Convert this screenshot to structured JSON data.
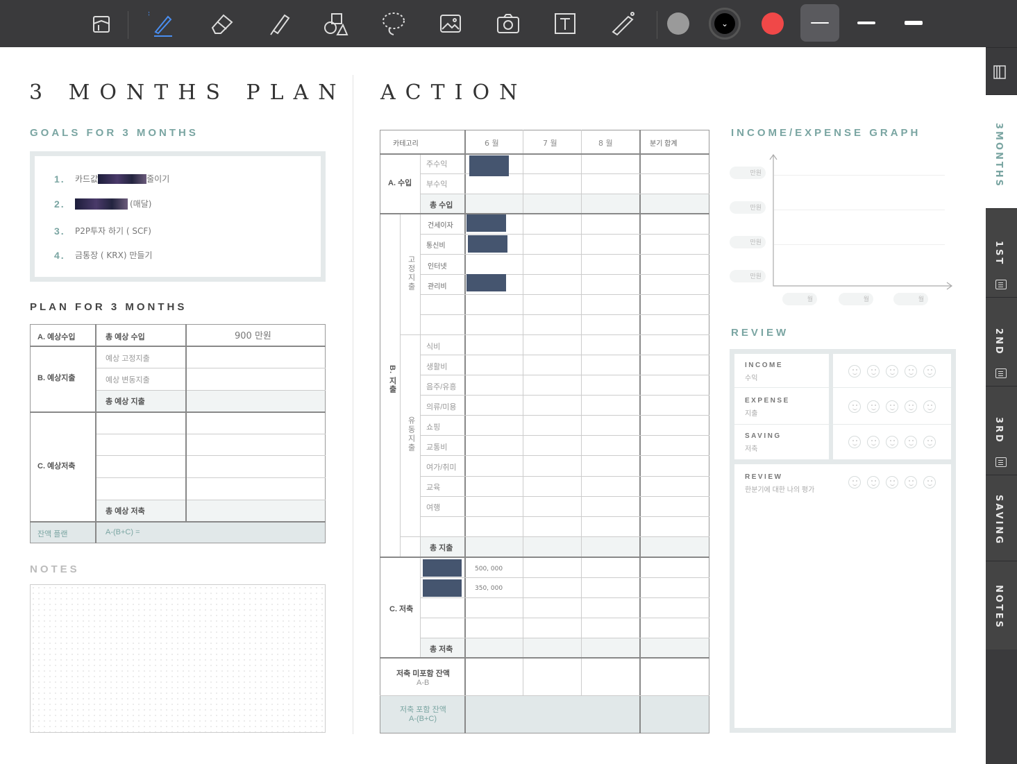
{
  "toolbar": {
    "tools": [
      "page-settings",
      "pen",
      "eraser",
      "highlighter",
      "shapes",
      "lasso",
      "image",
      "camera",
      "text",
      "laser-pointer"
    ],
    "colors": [
      "#9a9a9a",
      "#000000",
      "#f04848"
    ],
    "selected_color_chevron": "⌄"
  },
  "right_tabs": [
    "3MONTHS",
    "1ST",
    "2ND",
    "3RD",
    "SAVING",
    "NOTES"
  ],
  "left": {
    "title": "3 MONTHS PLAN",
    "goals_title": "GOALS FOR 3 MONTHS",
    "goals": [
      {
        "num": "1.",
        "text_a": "카드값 ",
        "text_b": "줄이기"
      },
      {
        "num": "2.",
        "text_a": "",
        "text_b": "(매달)"
      },
      {
        "num": "3.",
        "text_a": "P2P투자 하기 ( SCF)",
        "text_b": ""
      },
      {
        "num": "4.",
        "text_a": "금통장 ( KRX) 만들기",
        "text_b": ""
      }
    ],
    "plan_title": "PLAN FOR 3 MONTHS",
    "plan": {
      "a_label": "A. 예상수입",
      "a_total": "총 예상 수입",
      "a_value": "900 만원",
      "b_label": "B. 예상지출",
      "b_fixed": "예상 고정지출",
      "b_var": "예상 변동지출",
      "b_total": "총 예상 지출",
      "c_label": "C. 예상저축",
      "c_total": "총 예상 저축",
      "balance_label": "잔액 플랜",
      "balance_formula": "A-(B+C) ="
    },
    "notes_title": "NOTES"
  },
  "action": {
    "title": "ACTION",
    "headers": [
      "카테고리",
      "6 월",
      "7 월",
      "8 월",
      "분기 합계"
    ],
    "income_label": "A. 수입",
    "income_rows": [
      "주수익",
      "부수익"
    ],
    "income_total": "총 수입",
    "expense_label": "B. 지출",
    "fixed_label": "고정지출",
    "fixed_rows": [
      "건세이자",
      "통신비",
      "인터넷",
      "관리비"
    ],
    "var_label": "유동지출",
    "var_rows": [
      "식비",
      "생활비",
      "음주/유흥",
      "의류/미용",
      "쇼핑",
      "교통비",
      "여가/취미",
      "교육",
      "여행"
    ],
    "expense_total": "총 지출",
    "saving_label": "C. 저축",
    "saving_values": [
      "500, 000",
      "350, 000"
    ],
    "saving_total": "총 저축",
    "bal1_label": "저축 미포함 잔액",
    "bal1_formula": "A-B",
    "bal2_label": "저축 포함 잔액",
    "bal2_formula": "A-(B+C)"
  },
  "graph": {
    "title": "INCOME/EXPENSE GRAPH",
    "y_pills": [
      "만원",
      "만원",
      "만원",
      "만원"
    ],
    "x_pills": [
      "월",
      "월",
      "월"
    ]
  },
  "review": {
    "title": "REVIEW",
    "items": [
      {
        "title": "INCOME",
        "sub": "수익"
      },
      {
        "title": "EXPENSE",
        "sub": "지출"
      },
      {
        "title": "SAVING",
        "sub": "저축"
      },
      {
        "title": "REVIEW",
        "sub": "한분기에 대한 나의 평가"
      }
    ]
  }
}
